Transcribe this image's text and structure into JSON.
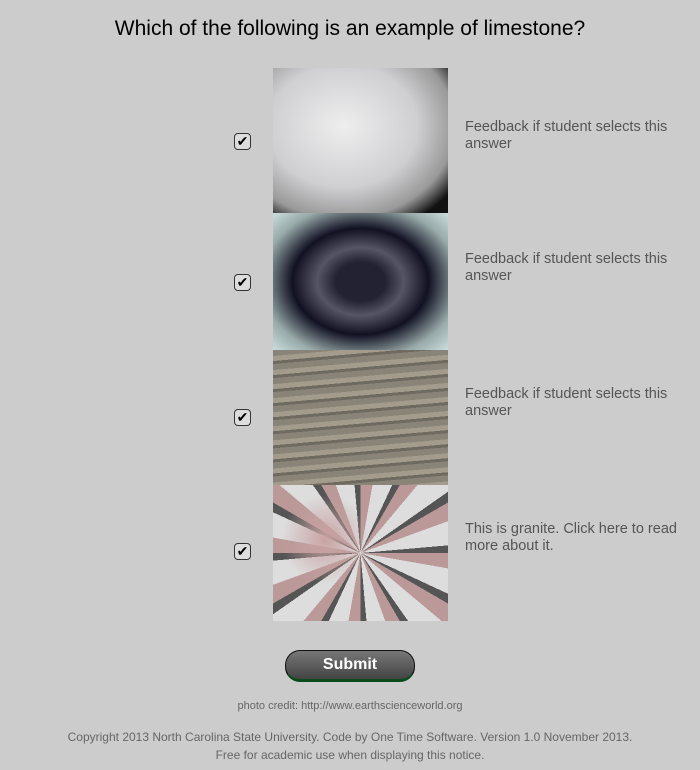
{
  "question": "Which of the following is an example of limestone?",
  "answers": [
    {
      "checked": true,
      "image": "white crystalline rock",
      "feedback": "Feedback if student selects this answer"
    },
    {
      "checked": true,
      "image": "black obsidian",
      "feedback": "Feedback if student selects this answer"
    },
    {
      "checked": true,
      "image": "layered gray rock",
      "feedback": "Feedback if student selects this answer"
    },
    {
      "checked": true,
      "image": "pink granite",
      "feedback": "This is granite. Click here to read more about it."
    }
  ],
  "check_glyph": "✔",
  "submit_label": "Submit",
  "credit": "photo credit: http://www.earthscienceworld.org",
  "copyright_line1": "Copyright 2013 North Carolina State University. Code by One Time Software. Version 1.0 November 2013.",
  "copyright_line2": "Free for academic use when displaying this notice."
}
